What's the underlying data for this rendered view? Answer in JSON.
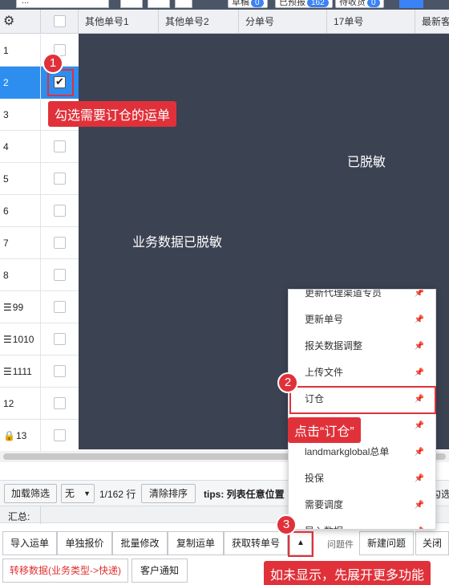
{
  "toolbar": {
    "dropdown_value": "...",
    "pills": [
      {
        "label": "草稿",
        "count": "0"
      },
      {
        "label": "已预报",
        "count": "162"
      },
      {
        "label": "待收货",
        "count": "0"
      }
    ]
  },
  "table": {
    "columns": [
      "其他单号1",
      "其他单号2",
      "分单号",
      "17单号",
      "最新客"
    ],
    "rows": [
      {
        "num": "1",
        "checked": false,
        "selected": false,
        "icon": ""
      },
      {
        "num": "2",
        "checked": true,
        "selected": true,
        "icon": ""
      },
      {
        "num": "3",
        "checked": false,
        "selected": false,
        "icon": ""
      },
      {
        "num": "4",
        "checked": false,
        "selected": false,
        "icon": ""
      },
      {
        "num": "5",
        "checked": false,
        "selected": false,
        "icon": ""
      },
      {
        "num": "6",
        "checked": false,
        "selected": false,
        "icon": ""
      },
      {
        "num": "7",
        "checked": false,
        "selected": false,
        "icon": ""
      },
      {
        "num": "8",
        "checked": false,
        "selected": false,
        "icon": ""
      },
      {
        "num": "99",
        "checked": false,
        "selected": false,
        "icon": "list-icon"
      },
      {
        "num": "1010",
        "checked": false,
        "selected": false,
        "icon": "list-icon"
      },
      {
        "num": "1111",
        "checked": false,
        "selected": false,
        "icon": "list-icon"
      },
      {
        "num": "12",
        "checked": false,
        "selected": false,
        "icon": ""
      },
      {
        "num": "13",
        "checked": false,
        "selected": false,
        "icon": "lock-icon"
      }
    ]
  },
  "mask": {
    "text_a": "已脱敏",
    "text_b": "业务数据已脱敏"
  },
  "pager": {
    "load_filter": "加载筛选",
    "filter_value": "无",
    "page_info": "1/162 行",
    "clear_sort": "清除排序",
    "tips": "tips: 列表任意位置",
    "tips_tail": "勾选使"
  },
  "summary": {
    "label": "汇总:"
  },
  "actions": {
    "row1": [
      "导入运单",
      "单独报价",
      "批量修改",
      "复制运单",
      "获取转单号"
    ],
    "row2": [
      "转移数据(业务类型->快递)",
      "客户通知"
    ],
    "expand": "▲",
    "problem_label": "问题件",
    "new_problem": "新建问题",
    "close": "关闭"
  },
  "menu": {
    "items": [
      "更新代理渠道专员",
      "更新单号",
      "报关数据调整",
      "上传文件",
      "订仓",
      "",
      "landmarkglobal总单",
      "投保",
      "需要调度",
      "导入数据"
    ]
  },
  "annotations": {
    "step1": "1",
    "step1_text": "勾选需要订仓的运单",
    "step2": "2",
    "step2_text": "点击“订仓”",
    "step3": "3",
    "step3_text": "如未显示，先展开更多功能"
  },
  "colors": {
    "mask": "#3b4252",
    "selected_row": "#2d8ef0",
    "annotation_red": "#e0313a"
  }
}
